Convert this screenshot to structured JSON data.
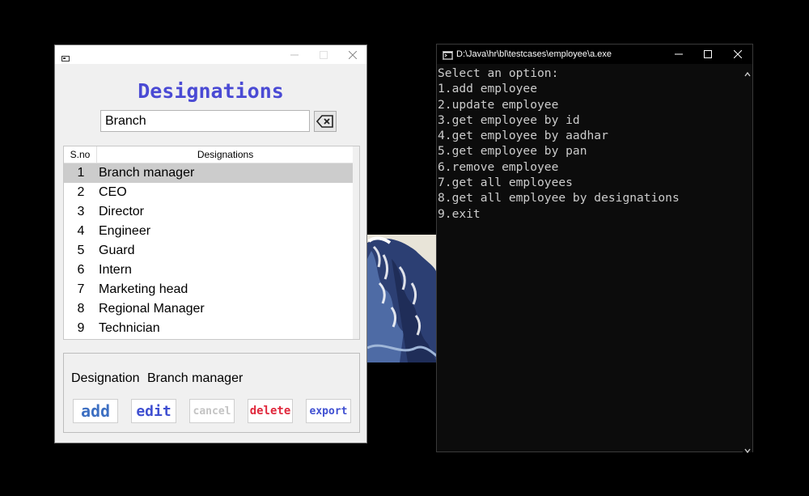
{
  "designations_window": {
    "title": "Designations",
    "search": {
      "value": "Branch"
    },
    "table": {
      "headers": {
        "sno": "S.no",
        "designation": "Designations"
      },
      "rows": [
        {
          "sno": "1",
          "name": "Branch manager",
          "selected": true
        },
        {
          "sno": "2",
          "name": "CEO"
        },
        {
          "sno": "3",
          "name": "Director"
        },
        {
          "sno": "4",
          "name": "Engineer"
        },
        {
          "sno": "5",
          "name": "Guard"
        },
        {
          "sno": "6",
          "name": "Intern"
        },
        {
          "sno": "7",
          "name": "Marketing head"
        },
        {
          "sno": "8",
          "name": "Regional Manager"
        },
        {
          "sno": "9",
          "name": "Technician"
        }
      ]
    },
    "detail": {
      "label": "Designation",
      "value": "Branch manager"
    },
    "buttons": {
      "add": "add",
      "edit": "edit",
      "cancel": "cancel",
      "delete": "delete",
      "export": "export"
    }
  },
  "console_window": {
    "title": "D:\\Java\\hr\\bl\\testcases\\employee\\a.exe",
    "lines": [
      "Select an option:",
      "1.add employee",
      "2.update employee",
      "3.get employee by id",
      "4.get employee by aadhar",
      "5.get employee by pan",
      "6.remove employee",
      "7.get all employees",
      "8.get all employee by designations",
      "9.exit"
    ]
  },
  "colors": {
    "title_accent": "#4a4ad4",
    "add": "#3d6fc2",
    "edit": "#3f4fd1",
    "cancel_disabled": "#c4c4c4",
    "delete": "#e0283c",
    "export": "#3f4fd1",
    "console_bg": "#0c0c0c",
    "console_text": "#cccccc"
  }
}
